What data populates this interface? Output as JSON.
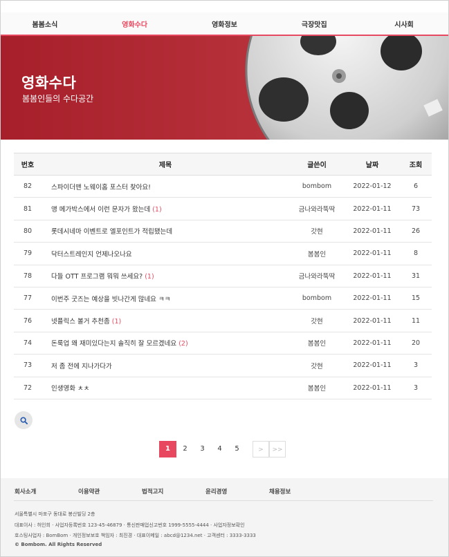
{
  "nav": {
    "items": [
      {
        "label": "봄봄소식",
        "active": false
      },
      {
        "label": "영화수다",
        "active": true
      },
      {
        "label": "영화정보",
        "active": false
      },
      {
        "label": "극장맛집",
        "active": false
      },
      {
        "label": "시사회",
        "active": false
      }
    ]
  },
  "hero": {
    "title": "영화수다",
    "subtitle": "봄봄인들의 수다공간"
  },
  "board": {
    "columns": [
      "번호",
      "제목",
      "글쓴이",
      "날짜",
      "조회"
    ],
    "rows": [
      {
        "no": "82",
        "title": "스파이더맨 노웨이홈 포스터 찾아요!",
        "comments": "",
        "author": "bombom",
        "date": "2022-01-12",
        "views": "6"
      },
      {
        "no": "81",
        "title": "앵 메가박스에서 이런 문자가 왔는데",
        "comments": "(1)",
        "author": "금나와라뚝딱",
        "date": "2022-01-11",
        "views": "73"
      },
      {
        "no": "80",
        "title": "롯데시네마 이벤트로 엘포인트가 적립됐는데",
        "comments": "",
        "author": "갓현",
        "date": "2022-01-11",
        "views": "26"
      },
      {
        "no": "79",
        "title": "닥터스트레인지 언제나오나요",
        "comments": "",
        "author": "봄봄인",
        "date": "2022-01-11",
        "views": "8"
      },
      {
        "no": "78",
        "title": "다들 OTT 프로그램 뭐뭐 쓰세요?",
        "comments": "(1)",
        "author": "금나와라뚝딱",
        "date": "2022-01-11",
        "views": "31"
      },
      {
        "no": "77",
        "title": "이번주 굿즈는 예상을 빗나간게 많네요 ㅋㅋ",
        "comments": "",
        "author": "bombom",
        "date": "2022-01-11",
        "views": "15"
      },
      {
        "no": "76",
        "title": "넷플릭스 볼거 추천좀",
        "comments": "(1)",
        "author": "갓현",
        "date": "2022-01-11",
        "views": "11"
      },
      {
        "no": "74",
        "title": "돈룩업 왜 재미있다는지 솔직히 잘 모르겠네요",
        "comments": "(2)",
        "author": "봄봄인",
        "date": "2022-01-11",
        "views": "20"
      },
      {
        "no": "73",
        "title": "저 좀 전에 지나가다가",
        "comments": "",
        "author": "갓현",
        "date": "2022-01-11",
        "views": "3"
      },
      {
        "no": "72",
        "title": "인생영화 ㅊㅊ",
        "comments": "",
        "author": "봄봄인",
        "date": "2022-01-11",
        "views": "3"
      }
    ]
  },
  "search": {
    "icon": "search-icon"
  },
  "pagination": {
    "pages": [
      "1",
      "2",
      "3",
      "4",
      "5"
    ],
    "current": "1",
    "next": ">",
    "last": ">>"
  },
  "footer": {
    "links": [
      "회사소개",
      "이용약관",
      "법적고지",
      "윤리경영",
      "채용정보"
    ],
    "address": "서울특별시 마포구 동대로 봉산빌딩 2층",
    "info1": "대표이사 : 허인희 · 사업자등록번호 123-45-46879 · 통신판매업신고번호 1999-5555-4444 · 사업자정보확인",
    "info2": "호스팅사업자 : BomBom · 개인정보보호 책임자 : 최진경 · 대표이메일 : abcd@1234.net · 고객센터 : 3333-3333",
    "copyright": "© Bombom. All Rights Reserved"
  },
  "colors": {
    "accent": "#e8485f",
    "hero": "#b6303a"
  }
}
